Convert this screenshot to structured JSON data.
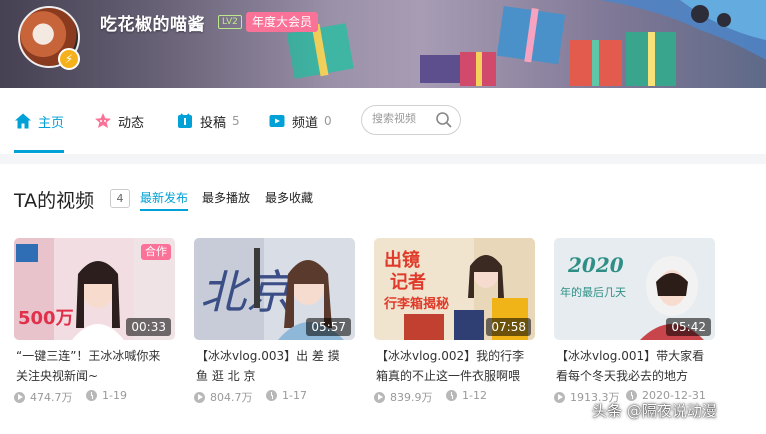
{
  "profile": {
    "username": "吃花椒的喵酱",
    "level": "LV2",
    "vip_label": "年度大会员",
    "avatar_icon": "red-panda-avatar",
    "badge_icon": "lightning-icon"
  },
  "nav": {
    "items": [
      {
        "label": "主页",
        "count": "",
        "icon": "home-icon",
        "active": true
      },
      {
        "label": "动态",
        "count": "",
        "icon": "activity-icon",
        "active": false
      },
      {
        "label": "投稿",
        "count": "5",
        "icon": "upload-icon",
        "active": false
      },
      {
        "label": "频道",
        "count": "0",
        "icon": "channel-icon",
        "active": false
      }
    ],
    "search_placeholder": "搜索视频"
  },
  "videos_section": {
    "title": "TA的视频",
    "count": "4",
    "sort_tabs": [
      "最新发布",
      "最多播放",
      "最多收藏"
    ],
    "active_sort": "最新发布"
  },
  "videos": [
    {
      "title": "“一键三连”！王冰冰喊你来关注央视新闻~",
      "duration": "00:33",
      "views": "474.7万",
      "date": "1-19",
      "badge": "合作"
    },
    {
      "title": "【冰冰vlog.003】出 差 摸 鱼 逛 北 京",
      "duration": "05:57",
      "views": "804.7万",
      "date": "1-17",
      "badge": ""
    },
    {
      "title": "【冰冰vlog.002】我的行李箱真的不止这一件衣服啊喂(·",
      "duration": "07:58",
      "views": "839.9万",
      "date": "1-12",
      "badge": ""
    },
    {
      "title": "【冰冰vlog.001】带大家看看每个冬天我必去的地方",
      "duration": "05:42",
      "views": "1913.3万",
      "date": "2020-12-31",
      "badge": ""
    }
  ],
  "thumb_text": {
    "t2": "北京",
    "t3_line1": "出镜",
    "t3_line2": "记者",
    "t3_line3": "行李箱揭秘",
    "t4_year": "2020",
    "t4_line": "年的最后几天",
    "t1_big": "500万"
  },
  "watermark": "头条 @隔夜说动漫",
  "colors": {
    "accent": "#00a1d6",
    "pink": "#fb7299",
    "gray_text": "#999999"
  }
}
